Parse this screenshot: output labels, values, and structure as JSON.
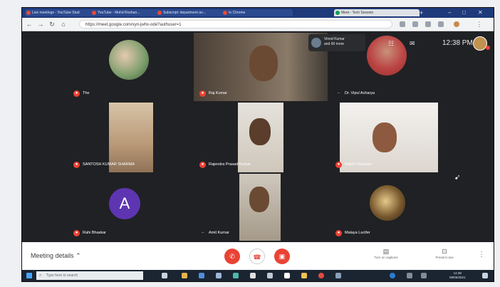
{
  "browser": {
    "tabs": [
      {
        "label": "Live meetings - YouTube Stud"
      },
      {
        "label": "YouTube - Mohd Roshan..."
      },
      {
        "label": "Subscript: department an..."
      },
      {
        "label": "In Chrome"
      },
      {
        "label": "Meet - Tech Session",
        "active": true
      }
    ],
    "new_tab": "+",
    "window_controls": [
      "–",
      "□",
      "✕"
    ],
    "url": "https://meet.google.com/xyn-jwhx-ode?authuser=1"
  },
  "meet": {
    "others_text_line1": "Vinod Kumar",
    "others_text_line2": "and 60 more",
    "time": "12:38 PM",
    "participants": [
      {
        "name": "The"
      },
      {
        "name": "Raj Kumar"
      },
      {
        "name": "Dr. Vipul Acharya"
      },
      {
        "name": "SANTOSH KUMAR SHARMA"
      },
      {
        "name": "Rajendra Prasad Kumar"
      },
      {
        "name": "Rakhi Chauhan"
      },
      {
        "name": "Rahi Bhaskar"
      },
      {
        "name": "Amit Kumar"
      },
      {
        "name": "Malaya Lucifer"
      }
    ],
    "letter_avatar": "A"
  },
  "controls": {
    "meeting_details": "Meeting details",
    "caption_label": "Turn on captions",
    "present_label": "Present now"
  },
  "taskbar": {
    "search_placeholder": "Type here to search",
    "time": "12:38",
    "date": "09/05/2021"
  },
  "colors": {
    "meet_bg": "#202124",
    "tile_bg": "#3c4043",
    "red": "#ea4335",
    "letter_avatar": "#5e35b1"
  }
}
